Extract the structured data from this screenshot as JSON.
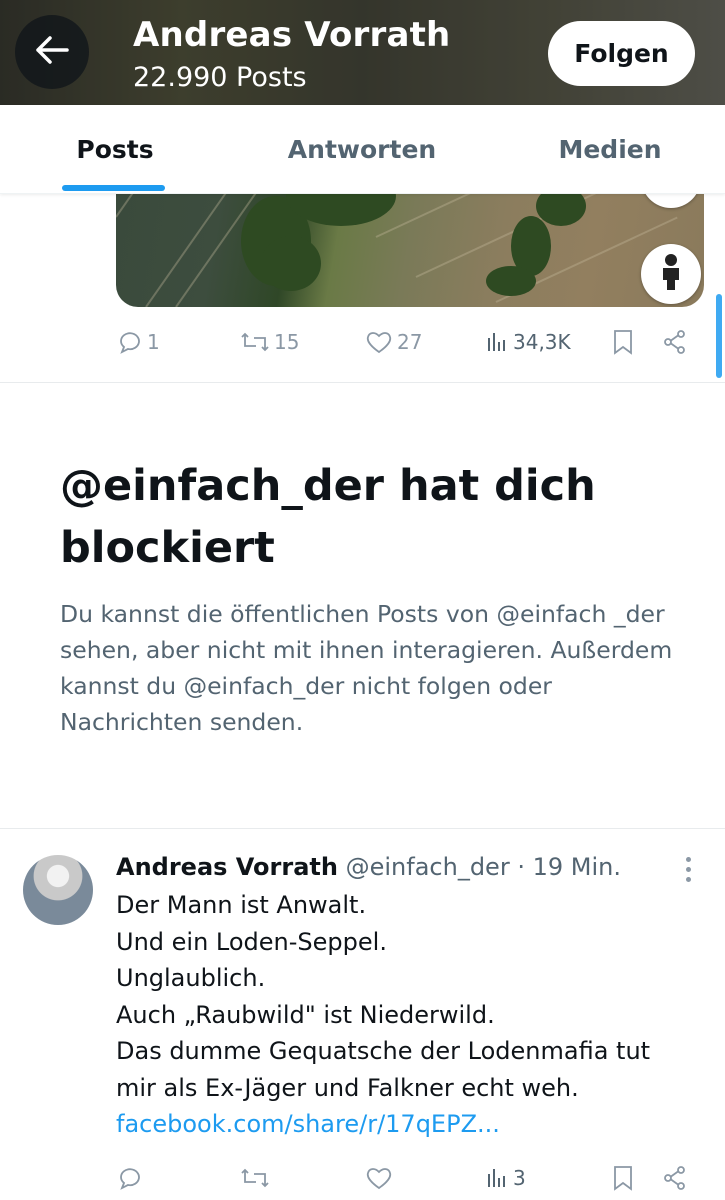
{
  "header": {
    "back_icon": "arrow-left-icon",
    "profile_name": "Andreas Vorrath",
    "post_count": "22.990 Posts",
    "follow_label": "Folgen"
  },
  "tabs": [
    {
      "label": "Posts",
      "active": true
    },
    {
      "label": "Antworten",
      "active": false
    },
    {
      "label": "Medien",
      "active": false
    }
  ],
  "previous_post": {
    "media_icons": [
      "compass-icon",
      "street-view-person-icon"
    ],
    "replies": "1",
    "reposts": "15",
    "likes": "27",
    "views": "34,3K"
  },
  "blocked_notice": {
    "title": "@einfach_der hat dich blockiert",
    "body": "Du kannst die öffentlichen Posts von @einfach _der sehen, aber nicht mit ihnen interagieren. Außerdem kannst du @einfach_der nicht folgen oder Nachrichten senden."
  },
  "tweet": {
    "author_name": "Andreas Vorrath",
    "handle": "@einfach_der",
    "time": "· 19 Min.",
    "lines": [
      "Der Mann ist Anwalt.",
      "Und ein Loden-Seppel.",
      "Unglaublich.",
      "Auch „Raubwild\" ist Niederwild.",
      "Das dumme Gequatsche der Lodenmafia tut",
      "mir als Ex-Jäger und Falkner echt weh."
    ],
    "link": "facebook.com/share/r/17qEPZ...",
    "replies": "",
    "reposts": "",
    "likes": "",
    "views": "3"
  },
  "colors": {
    "accent": "#1d9bf0",
    "text_primary": "#0f1419",
    "text_secondary": "#536471"
  }
}
